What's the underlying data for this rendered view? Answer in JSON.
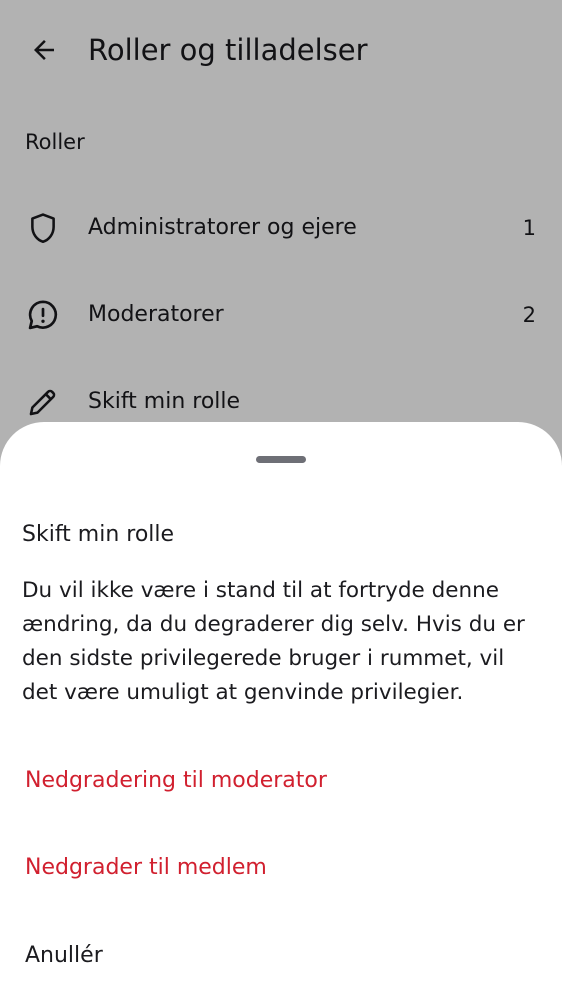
{
  "appbar": {
    "title": "Roller og tilladelser",
    "back_icon": "arrow-back-icon"
  },
  "roles_section": {
    "header": "Roller",
    "items": [
      {
        "label": "Administratorer og ejere",
        "count": "1",
        "icon": "shield-icon"
      },
      {
        "label": "Moderatorer",
        "count": "2",
        "icon": "alert-chat-icon"
      },
      {
        "label": "Skift min rolle",
        "count": "",
        "icon": "pencil-icon"
      }
    ]
  },
  "sheet": {
    "title": "Skift min rolle",
    "message": "Du vil ikke være i stand til at fortryde denne ændring, da du degraderer dig selv. Hvis du er den sidste privilegerede bruger i rummet, vil det være umuligt at genvinde privilegier.",
    "actions": {
      "demote_moderator": "Nedgradering til moderator",
      "demote_member": "Nedgrader til medlem",
      "cancel": "Anullér"
    }
  },
  "colors": {
    "danger": "#d1202f",
    "text": "#1b1b1f",
    "scrim": "rgba(0,0,0,0.30)"
  }
}
